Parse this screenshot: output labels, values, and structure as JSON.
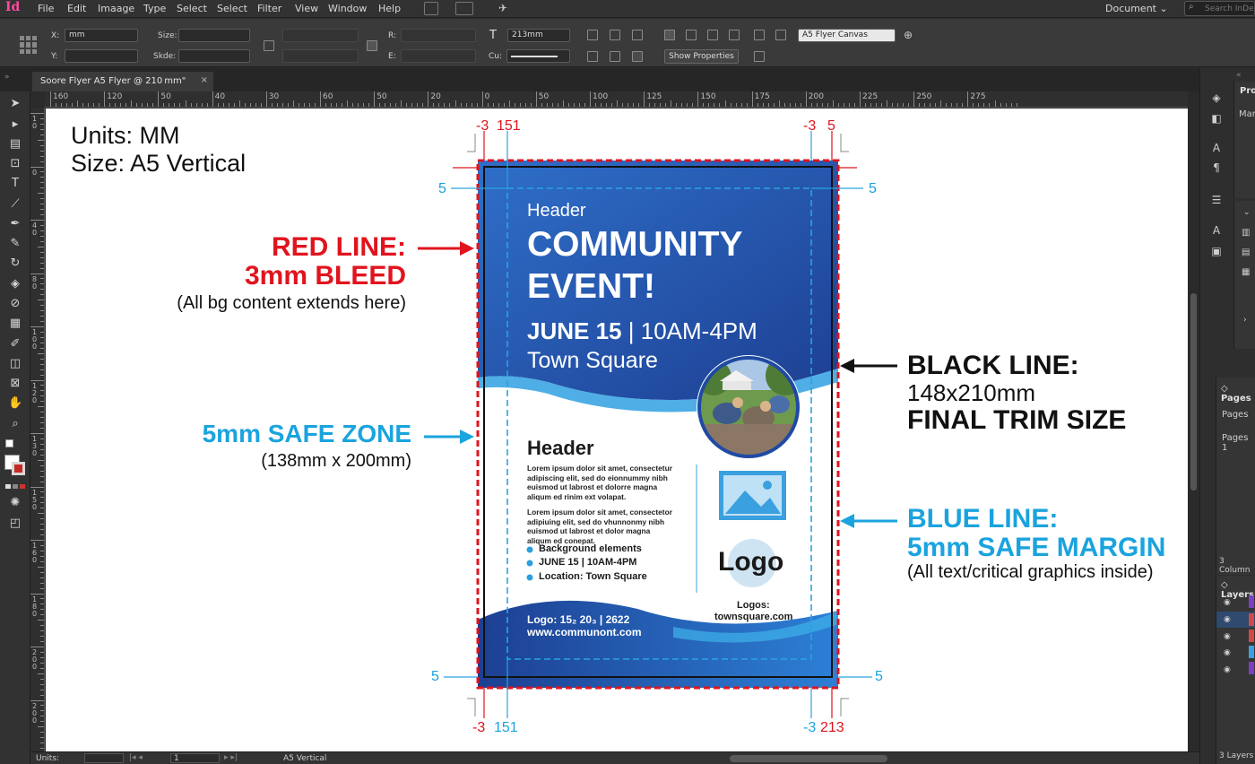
{
  "app": {
    "logo": "Id"
  },
  "menu": [
    "File",
    "Edit",
    "Imaage",
    "Type",
    "Select",
    "Select",
    "Filter",
    "View",
    "Window",
    "Help"
  ],
  "workspace": {
    "label": "Document",
    "search_placeholder": "Search InDesign"
  },
  "control": {
    "x_label": "X:",
    "y_label": "Y:",
    "x_value": "mm",
    "y_value": "",
    "size_label": "Size:",
    "skew_label": "Skde:",
    "r_label": "R:",
    "e_label": "E:",
    "font_size": "213mm",
    "cu_label": "Cu:",
    "style_select": "A5 Flyer Canvas",
    "show_properties": "Show Properties"
  },
  "document_tab": {
    "title": "Soore Flyer A5 Flyer @ 210 mm\"",
    "close": "×"
  },
  "ruler": {
    "h_labels": [
      "160",
      "120",
      "50",
      "40",
      "30",
      "60",
      "50",
      "20",
      "0",
      "50",
      "100",
      "125",
      "150",
      "175",
      "200",
      "225",
      "250",
      "275"
    ],
    "v_labels": [
      "10",
      "0",
      "40",
      "80",
      "100",
      "120",
      "130",
      "150",
      "160",
      "180",
      "200",
      "200"
    ]
  },
  "annotations": {
    "units": "Units: MM",
    "size": "Size: A5 Vertical",
    "red_title1": "RED LINE:",
    "red_title2": "3mm BLEED",
    "red_sub": "(All bg content extends here)",
    "safe_title": "5mm SAFE ZONE",
    "safe_sub": "(138mm x 200mm)",
    "black_title": "BLACK LINE:",
    "black_dims": "148x210mm",
    "black_sub": "FINAL TRIM SIZE",
    "blue_title1": "BLUE LINE:",
    "blue_title2": "5mm SAFE MARGIN",
    "blue_sub": "(All text/critical graphics inside)",
    "dims": {
      "top_left_red": "-3",
      "top_left_blue": "151",
      "top_right_red": "-3",
      "top_right_blue": "5",
      "left_upper": "5",
      "right_upper": "5",
      "left_lower": "5",
      "right_lower": "5",
      "bottom_left_red": "-3",
      "bottom_left_blue": "151",
      "bottom_right_blue": "-3",
      "bottom_right_red": "213"
    }
  },
  "flyer": {
    "header_small": "Header",
    "title_line1": "COMMUNITY",
    "title_line2": "EVENT!",
    "date": "JUNE 15",
    "sep": "|",
    "time": "10AM-4PM",
    "place": "Town Square",
    "section_header": "Header",
    "lorem1": [
      "Lorem ipsum dolor sit amet, consectetur",
      "adipiscing elit, sed do eionnummy nibh",
      "euismod ut labrost et dolorre magna",
      "aliqum ed rinim ext volapat."
    ],
    "lorem2": [
      "Lorem ipsum dolor sit amet, consectetor",
      "adipiuing elit, sed do vhunnonmy nibh",
      "euismod ut labrost et dolor magna",
      "aliqum ed conepat."
    ],
    "bullets": [
      "Background elements",
      "JUNE 15 | 10AM-4PM",
      "Location: Town Square"
    ],
    "logo": "Logo",
    "logos_label": "Logos:",
    "logos_url": "townsquare.com",
    "footer_line1": "Logo: 15₂ 20₃ | 2622",
    "footer_line2": "www.communont.com"
  },
  "right_panels": {
    "props_title": "Pro",
    "props_row": "Mar",
    "pages_title": "Pages",
    "pages_row1": "Pages",
    "pages_row2": "Pages 1",
    "columns": "3 Column",
    "layers_title": "Layers",
    "layers_footer": "3 Layers"
  },
  "status": {
    "units_label": "Units:",
    "page": "1",
    "page_name": "A5 Vertical"
  },
  "colors": {
    "red": "#e0141e",
    "blue": "#1aa3de",
    "navy": "#1f4aa3"
  }
}
